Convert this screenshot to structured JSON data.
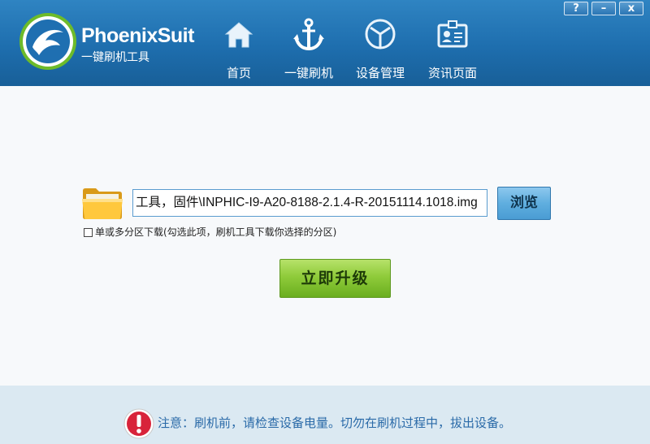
{
  "app": {
    "brand_name": "PhoenixSuit",
    "brand_subtitle": "一键刷机工具"
  },
  "nav": {
    "home": "首页",
    "flash": "一键刷机",
    "device": "设备管理",
    "news": "资讯页面"
  },
  "window": {
    "help": "?",
    "minimize": "–",
    "close": "x"
  },
  "flash": {
    "path_value": "工具，固件\\INPHIC-I9-A20-8188-2.1.4-R-20151114.1018.img",
    "browse_label": "浏览",
    "multi_partition_label": "单或多分区下载(勾选此项，刷机工具下载你选择的分区)",
    "upgrade_label": "立即升级"
  },
  "footer": {
    "warning": "注意：刷机前，请检查设备电量。切勿在刷机过程中，拔出设备。"
  }
}
